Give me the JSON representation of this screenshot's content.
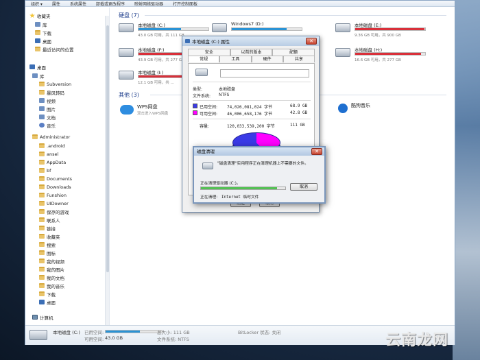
{
  "menu": [
    "组织 ▾",
    "属性",
    "系统属性",
    "卸载或更改程序",
    "映射网络驱动器",
    "打开控制面板"
  ],
  "nav": {
    "favorites": "收藏夹",
    "fav_items": [
      "库",
      "下载",
      "桌面",
      "最近访问的位置"
    ],
    "desktop": "桌面",
    "library": "库",
    "lib_items": [
      "Subversion",
      "暴风转码",
      "视频",
      "图片",
      "文档",
      "音乐"
    ],
    "admin": "Administrator",
    "admin_items": [
      ".android",
      "ansel",
      "AppData",
      "bf",
      "Documents",
      "Downloads",
      "Funshion",
      "UIDowner",
      "保存的游戏",
      "联系人",
      "链接",
      "收藏夹",
      "搜索",
      "图标",
      "我的视频",
      "我的图片",
      "我的文档",
      "我的音乐",
      "下载",
      "桌面"
    ],
    "computer": "计算机"
  },
  "hdd_group": "硬盘 (7)",
  "drives": [
    {
      "name": "本地磁盘 (C:)",
      "info": "43.0 GB 可用，共 111 GB",
      "used": 0.61,
      "color": "#2a93d5"
    },
    {
      "name": "Windows7 (D:)",
      "info": "",
      "used": 0.78,
      "color": "#2a93d5"
    },
    {
      "name": "本地磁盘 (E:)",
      "info": "9.36 GB 可用，共 900 GB",
      "used": 0.99,
      "color": "#d9303a"
    },
    {
      "name": "本地磁盘 (F:)",
      "info": "43.9 GB 可用，共 277 GB",
      "used": 0.84,
      "color": "#d9303a"
    },
    {
      "name": "本地磁盘 (H:)",
      "info": "16.6 GB 可用，共 277 GB",
      "used": 0.94,
      "color": "#d9303a"
    },
    {
      "name": "本地磁盘 (I:)",
      "info": "12.1 GB 可用，共 ...",
      "used": 0.9,
      "color": "#d9303a"
    }
  ],
  "other_group": "其他 (3)",
  "other_apps": [
    {
      "title": "WPS网盘",
      "sub": "双击进入WPS网盘"
    },
    {
      "title": "酷狗音乐",
      "sub": ""
    }
  ],
  "status": {
    "name": "本地磁盘 (C:)",
    "used_label": "已用空间:",
    "free_label": "可用空间:",
    "free_val": "43.0 GB",
    "total": "总大小: 111 GB",
    "fs": "文件系统: NTFS",
    "bitlocker": "BitLocker 状态: 关闭",
    "used_frac": 0.61
  },
  "props": {
    "title": "本地磁盘 (C:) 属性",
    "tabs_top": [
      "安全",
      "以前的版本",
      "配额"
    ],
    "tabs_bottom": [
      "常规",
      "工具",
      "硬件",
      "共享"
    ],
    "type_label": "类型:",
    "type_val": "本地磁盘",
    "fs_label": "文件系统:",
    "fs_val": "NTFS",
    "used_label": "已用空间:",
    "used_bytes": "74,026,081,024 字节",
    "used_gb": "68.9 GB",
    "free_label": "可用空间:",
    "free_bytes": "46,006,658,176 字节",
    "free_gb": "42.8 GB",
    "cap_label": "容量:",
    "cap_bytes": "120,033,539,200 字节",
    "cap_gb": "111 GB",
    "ok": "确定",
    "cancel": "取消",
    "used_color": "#3a3ae6",
    "free_color": "#ff00ff"
  },
  "cleanup": {
    "title": "磁盘清理",
    "message": "\"磁盘清理\"实用程序正在清理机器上不需要的文件。",
    "cleaning_drive": "正在清理驱动器 (C:)。",
    "cancel": "取消",
    "cleaning_label": "正在清理:",
    "cleaning_item": "Internet 临时文件",
    "progress": 0.9
  },
  "watermark": "云南龙网"
}
